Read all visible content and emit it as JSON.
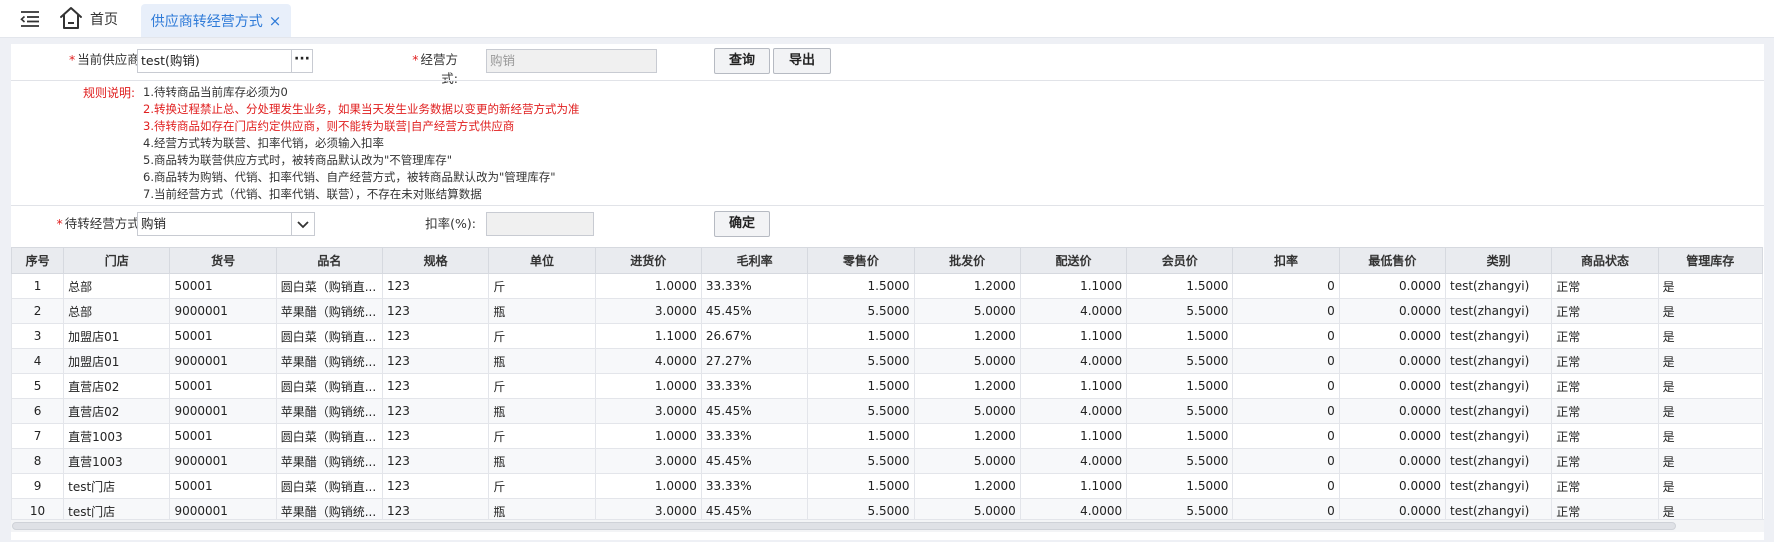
{
  "nav": {
    "home_label": "首页",
    "active_tab_label": "供应商转经营方式",
    "close_glyph": "×"
  },
  "form": {
    "supplier_label": "当前供应商:",
    "supplier_value": "test(购销)",
    "supplier_picker": "···",
    "mode_label": "经营方式:",
    "mode_placeholder": "购销",
    "query_button": "查询",
    "export_button": "导出"
  },
  "rules": {
    "label": "规则说明:",
    "items": [
      "1.待转商品当前库存必须为0",
      "2.转换过程禁止总、分处理发生业务，如果当天发生业务数据以变更的新经营方式为准",
      "3.待转商品如存在门店约定供应商，则不能转为联营|自产经营方式供应商",
      "4.经营方式转为联营、扣率代销，必须输入扣率",
      "5.商品转为联营供应方式时，被转商品默认改为\"不管理库存\"",
      "6.商品转为购销、代销、扣率代销、自产经营方式，被转商品默认改为\"管理库存\"",
      "7.当前经营方式（代销、扣率代销、联营），不存在未对账结算数据"
    ]
  },
  "convert": {
    "target_label": "待转经营方式:",
    "target_value": "购销",
    "rate_label": "扣率(%):",
    "rate_value": "",
    "confirm_button": "确定"
  },
  "table": {
    "columns": [
      "序号",
      "门店",
      "货号",
      "品名",
      "规格",
      "单位",
      "进货价",
      "毛利率",
      "零售价",
      "批发价",
      "配送价",
      "会员价",
      "扣率",
      "最低售价",
      "类别",
      "商品状态",
      "管理库存"
    ],
    "rows": [
      [
        "1",
        "总部",
        "50001",
        "圆白菜（购销直...",
        "123",
        "斤",
        "1.0000",
        "33.33%",
        "1.5000",
        "1.2000",
        "1.1000",
        "1.5000",
        "0",
        "0.0000",
        "test(zhangyi)",
        "正常",
        "是"
      ],
      [
        "2",
        "总部",
        "9000001",
        "苹果醋（购销统...",
        "123",
        "瓶",
        "3.0000",
        "45.45%",
        "5.5000",
        "5.0000",
        "4.0000",
        "5.5000",
        "0",
        "0.0000",
        "test(zhangyi)",
        "正常",
        "是"
      ],
      [
        "3",
        "加盟店01",
        "50001",
        "圆白菜（购销直...",
        "123",
        "斤",
        "1.1000",
        "26.67%",
        "1.5000",
        "1.2000",
        "1.1000",
        "1.5000",
        "0",
        "0.0000",
        "test(zhangyi)",
        "正常",
        "是"
      ],
      [
        "4",
        "加盟店01",
        "9000001",
        "苹果醋（购销统...",
        "123",
        "瓶",
        "4.0000",
        "27.27%",
        "5.5000",
        "5.0000",
        "4.0000",
        "5.5000",
        "0",
        "0.0000",
        "test(zhangyi)",
        "正常",
        "是"
      ],
      [
        "5",
        "直营店02",
        "50001",
        "圆白菜（购销直...",
        "123",
        "斤",
        "1.0000",
        "33.33%",
        "1.5000",
        "1.2000",
        "1.1000",
        "1.5000",
        "0",
        "0.0000",
        "test(zhangyi)",
        "正常",
        "是"
      ],
      [
        "6",
        "直营店02",
        "9000001",
        "苹果醋（购销统...",
        "123",
        "瓶",
        "3.0000",
        "45.45%",
        "5.5000",
        "5.0000",
        "4.0000",
        "5.5000",
        "0",
        "0.0000",
        "test(zhangyi)",
        "正常",
        "是"
      ],
      [
        "7",
        "直营1003",
        "50001",
        "圆白菜（购销直...",
        "123",
        "斤",
        "1.0000",
        "33.33%",
        "1.5000",
        "1.2000",
        "1.1000",
        "1.5000",
        "0",
        "0.0000",
        "test(zhangyi)",
        "正常",
        "是"
      ],
      [
        "8",
        "直营1003",
        "9000001",
        "苹果醋（购销统...",
        "123",
        "瓶",
        "3.0000",
        "45.45%",
        "5.5000",
        "5.0000",
        "4.0000",
        "5.5000",
        "0",
        "0.0000",
        "test(zhangyi)",
        "正常",
        "是"
      ],
      [
        "9",
        "test门店",
        "50001",
        "圆白菜（购销直...",
        "123",
        "斤",
        "1.0000",
        "33.33%",
        "1.5000",
        "1.2000",
        "1.1000",
        "1.5000",
        "0",
        "0.0000",
        "test(zhangyi)",
        "正常",
        "是"
      ],
      [
        "10",
        "test门店",
        "9000001",
        "苹果醋（购销统...",
        "123",
        "瓶",
        "3.0000",
        "45.45%",
        "5.5000",
        "5.0000",
        "4.0000",
        "5.5000",
        "0",
        "0.0000",
        "test(zhangyi)",
        "正常",
        "是"
      ]
    ]
  },
  "colors": {
    "accent": "#2f7bd8",
    "required": "#e02020",
    "header_bg": "#e9ebef"
  }
}
